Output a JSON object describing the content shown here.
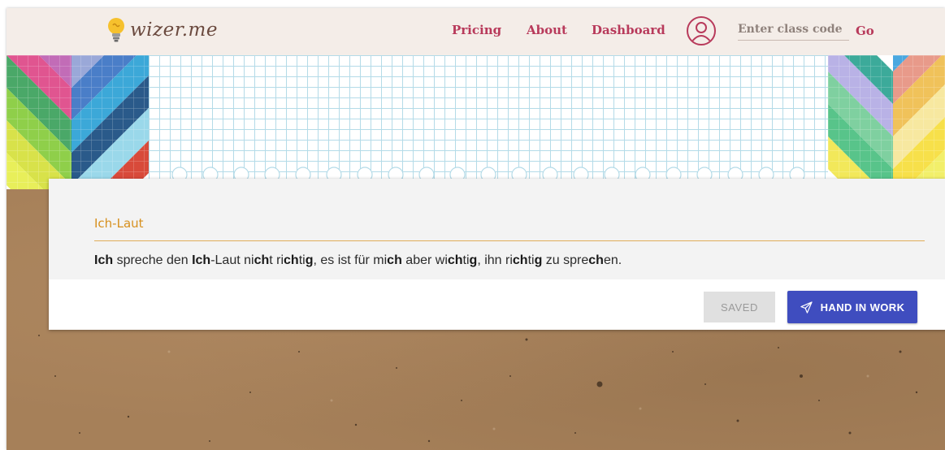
{
  "header": {
    "logo_text": "wizer.me",
    "nav": [
      {
        "label": "Pricing"
      },
      {
        "label": "About"
      },
      {
        "label": "Dashboard"
      }
    ],
    "class_code_placeholder": "Enter class code",
    "go_label": "Go"
  },
  "icons": {
    "logo": "lightbulb-icon",
    "avatar": "user-circle-icon",
    "hand_in": "paper-plane-icon"
  },
  "colors": {
    "nav_text": "#b83a5b",
    "header_bg": "#f4ede8",
    "card_title": "#d7901e",
    "primary_button": "#3f4dbf",
    "saved_button": "#e0e0e0"
  },
  "card": {
    "title": "Ich-Laut",
    "sentence": [
      {
        "t": "Ich",
        "b": true
      },
      {
        "t": " spreche den ",
        "b": false
      },
      {
        "t": "Ich",
        "b": true
      },
      {
        "t": "-Laut ni",
        "b": false
      },
      {
        "t": "ch",
        "b": true
      },
      {
        "t": "t ri",
        "b": false
      },
      {
        "t": "ch",
        "b": true
      },
      {
        "t": "ti",
        "b": false
      },
      {
        "t": "g",
        "b": true
      },
      {
        "t": ", es ist für mi",
        "b": false
      },
      {
        "t": "ch",
        "b": true
      },
      {
        "t": " aber wi",
        "b": false
      },
      {
        "t": "ch",
        "b": true
      },
      {
        "t": "ti",
        "b": false
      },
      {
        "t": "g",
        "b": true
      },
      {
        "t": ", ihn ri",
        "b": false
      },
      {
        "t": "ch",
        "b": true
      },
      {
        "t": "ti",
        "b": false
      },
      {
        "t": "g",
        "b": true
      },
      {
        "t": " zu spre",
        "b": false
      },
      {
        "t": "ch",
        "b": true
      },
      {
        "t": "en.",
        "b": false
      }
    ]
  },
  "actions": {
    "saved_label": "SAVED",
    "hand_in_label": "HAND IN WORK"
  }
}
